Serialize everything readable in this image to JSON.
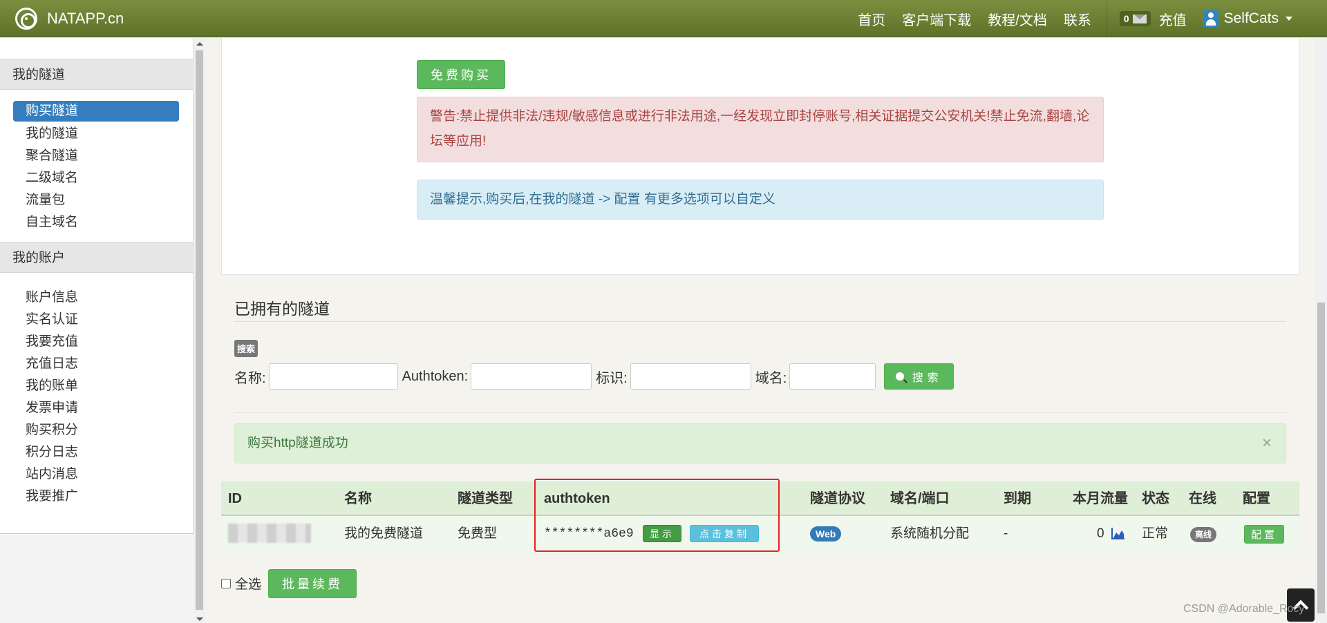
{
  "navbar": {
    "brand": "NATAPP.cn",
    "links": [
      "首页",
      "客户端下载",
      "教程/文档",
      "联系"
    ],
    "msg_count": "0",
    "recharge": "充值",
    "username": "SelfCats"
  },
  "sidebar": {
    "tunnels_header": "我的隧道",
    "tunnel_items": [
      "购买隧道",
      "我的隧道",
      "聚合隧道",
      "二级域名",
      "流量包",
      "自主域名"
    ],
    "account_header": "我的账户",
    "account_items": [
      "账户信息",
      "实名认证",
      "我要充值",
      "充值日志",
      "我的账单",
      "发票申请",
      "购买积分",
      "积分日志",
      "站内消息",
      "我要推广"
    ]
  },
  "purchase": {
    "buy_button": "免费购买",
    "warning": "警告:禁止提供非法/违规/敏感信息或进行非法用途,一经发现立即封停账号,相关证据提交公安机关!禁止免流,翻墙,论坛等应用!",
    "tip": "温馨提示,购买后,在我的隧道 -> 配置 有更多选项可以自定义"
  },
  "owned": {
    "title": "已拥有的隧道",
    "search_tag": "搜索",
    "name_label": "名称:",
    "authtoken_label": "Authtoken:",
    "tag_label": "标识:",
    "domain_label": "域名:",
    "search_button": "搜索",
    "success": "购买http隧道成功",
    "close": "×"
  },
  "table": {
    "headers": [
      "ID",
      "名称",
      "隧道类型",
      "authtoken",
      "隧道协议",
      "域名/端口",
      "到期",
      "本月流量",
      "状态",
      "在线",
      "配置"
    ],
    "row": {
      "name": "我的免费隧道",
      "type": "免费型",
      "authtoken": "********a6e9",
      "show_button": "显示",
      "copy_button": "点击复制",
      "protocol": "Web",
      "domain": "系统随机分配",
      "expire": "-",
      "traffic": "0",
      "status": "正常",
      "online": "离线",
      "config_button": "配置"
    }
  },
  "footer": {
    "select_all": "全选",
    "batch_renew": "批量续费",
    "watermark": "CSDN @Adorable_Rocy"
  }
}
